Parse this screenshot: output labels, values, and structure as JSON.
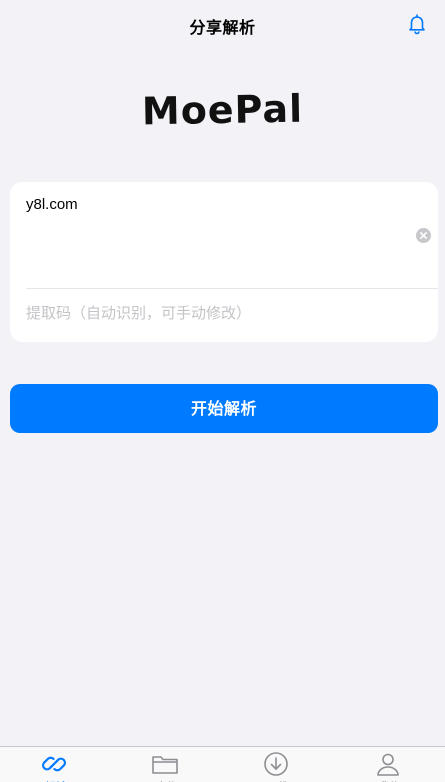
{
  "nav": {
    "title": "分享解析"
  },
  "logo": {
    "text": "MoePal"
  },
  "form": {
    "link_value": "y8l.com",
    "code_placeholder": "提取码（自动识别，可手动修改）"
  },
  "start_button": {
    "label": "开始解析"
  },
  "tabs": [
    {
      "label": "解析",
      "icon": "link-icon",
      "active": true
    },
    {
      "label": "文件",
      "icon": "folder-icon",
      "active": false
    },
    {
      "label": "下载",
      "icon": "download-icon",
      "active": false
    },
    {
      "label": "我的",
      "icon": "person-icon",
      "active": false
    }
  ],
  "colors": {
    "accent": "#007aff",
    "background": "#f2f2f7",
    "inactive_tab": "#8e8e93"
  }
}
